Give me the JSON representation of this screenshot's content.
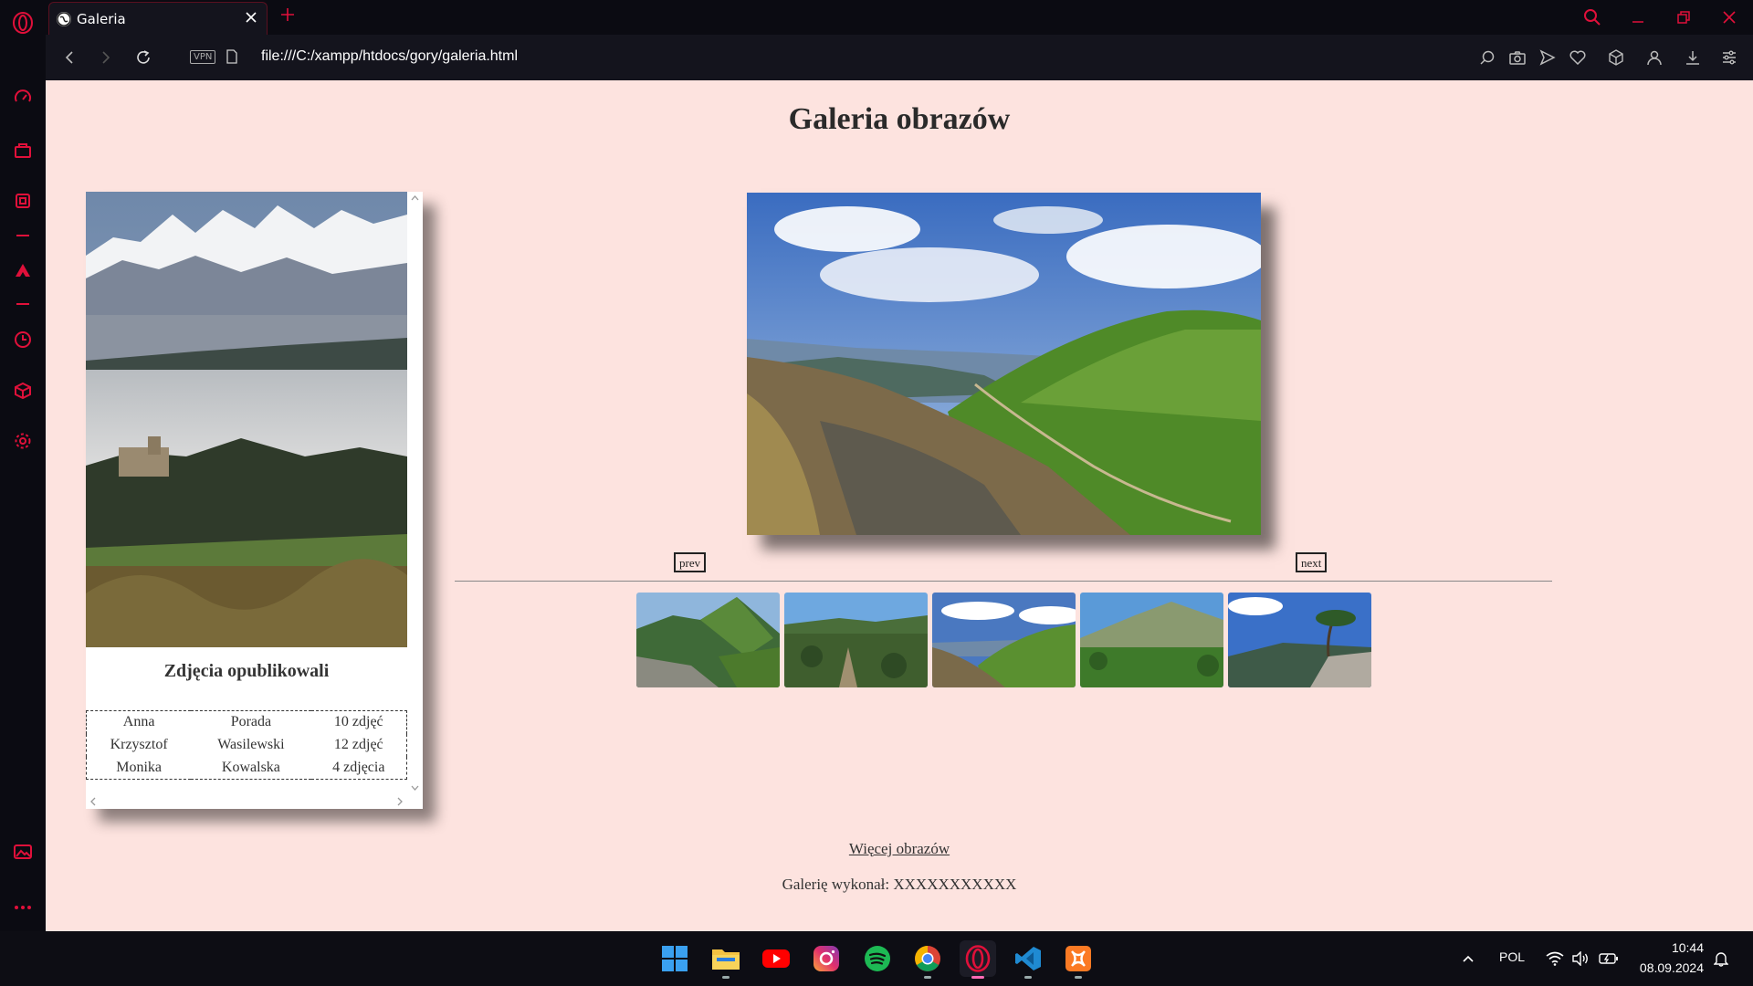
{
  "browser": {
    "tab_title": "Galeria",
    "url": "file:///C:/xampp/htdocs/gory/galeria.html",
    "vpn_label": "VPN",
    "accent": "#e0103a"
  },
  "page": {
    "title": "Galeria obrazów",
    "authors_heading": "Zdjęcia opublikowali",
    "authors": [
      {
        "first": "Anna",
        "last": "Porada",
        "count": "10 zdjęć"
      },
      {
        "first": "Krzysztof",
        "last": "Wasilewski",
        "count": "12 zdjęć"
      },
      {
        "first": "Monika",
        "last": "Kowalska",
        "count": "4 zdjęcia"
      }
    ],
    "prev_label": "prev",
    "next_label": "next",
    "more_link": "Więcej obrazów",
    "footer": "Galerię wykonał: XXXXXXXXXXX",
    "background": "#fde3df"
  },
  "taskbar": {
    "apps": [
      "windows-start",
      "file-explorer",
      "youtube",
      "instagram",
      "spotify",
      "chrome",
      "opera",
      "vscode",
      "xampp"
    ],
    "language": "POL",
    "time": "10:44",
    "date": "08.09.2024"
  }
}
